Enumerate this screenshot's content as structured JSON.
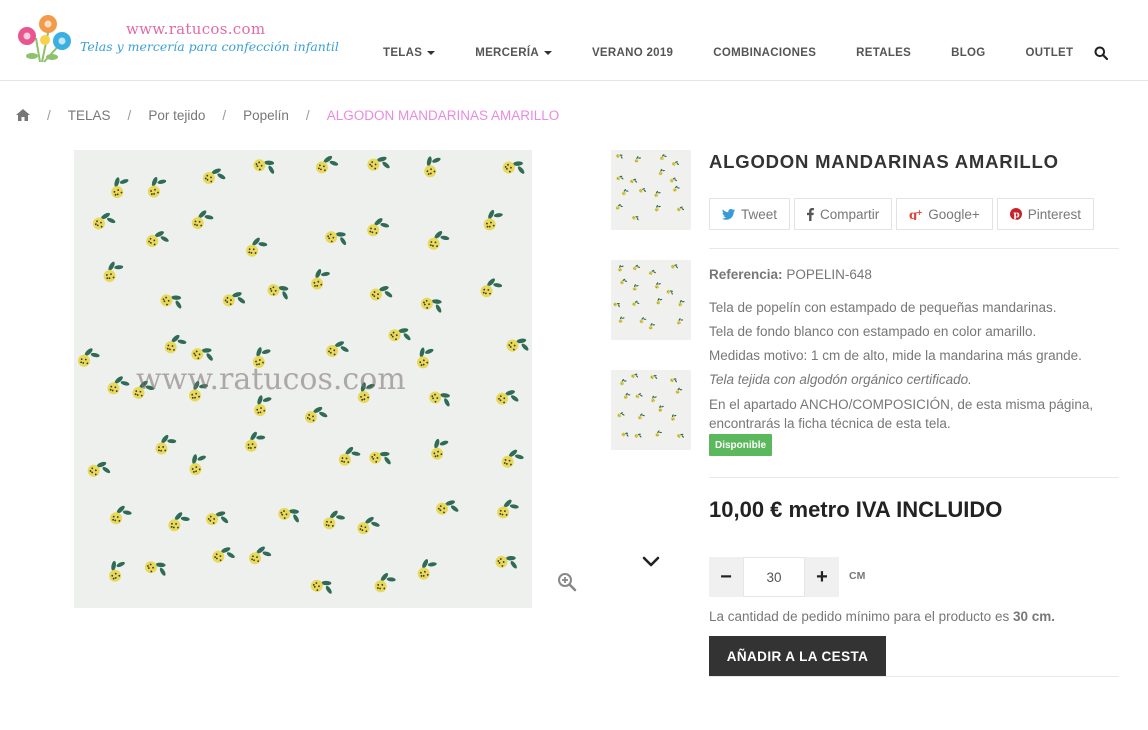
{
  "header": {
    "logo_url": "www.ratucos.com",
    "logo_tagline": "Telas y mercería para confección infantil",
    "nav": [
      {
        "label": "TELAS",
        "dropdown": true
      },
      {
        "label": "MERCERÍA",
        "dropdown": true
      },
      {
        "label": "VERANO 2019",
        "dropdown": false
      },
      {
        "label": "COMBINACIONES",
        "dropdown": false
      },
      {
        "label": "RETALES",
        "dropdown": false
      },
      {
        "label": "BLOG",
        "dropdown": false
      },
      {
        "label": "OUTLET",
        "dropdown": false
      }
    ],
    "search_icon": "search-icon"
  },
  "breadcrumb": {
    "home_icon": "home-icon",
    "separator": "/",
    "items": [
      "TELAS",
      "Por tejido",
      "Popelín"
    ],
    "current": "ALGODON MANDARINAS AMARILLO"
  },
  "gallery": {
    "watermark": "www.ratucos.com",
    "zoom_icon": "zoom-in-icon",
    "next_icon": "chevron-down-icon"
  },
  "product": {
    "title": "ALGODON MANDARINAS AMARILLO",
    "share": [
      {
        "label": "Tweet",
        "icon": "twitter-icon"
      },
      {
        "label": "Compartir",
        "icon": "facebook-icon"
      },
      {
        "label": "Google+",
        "icon": "google-plus-icon"
      },
      {
        "label": "Pinterest",
        "icon": "pinterest-icon"
      }
    ],
    "reference_label": "Referencia:",
    "reference_value": "POPELIN-648",
    "description": [
      "Tela de popelín con estampado de pequeñas mandarinas.",
      "Tela de fondo blanco con estampado en color amarillo.",
      "Medidas motivo: 1 cm de alto, mide la mandarina más grande.",
      "Tela tejida con algodón orgánico certificado.",
      "En el apartado ANCHO/COMPOSICIÓN, de esta misma página, encontrarás la ficha técnica de esta tela."
    ],
    "availability": "Disponible",
    "price": "10,00 € metro IVA INCLUIDO",
    "quantity": {
      "minus": "−",
      "value": "30",
      "plus": "+",
      "unit": "CM"
    },
    "min_order_text": "La cantidad de pedido mínimo para el producto es",
    "min_order_value": "30 cm.",
    "add_to_cart": "AÑADIR A LA CESTA"
  },
  "colors": {
    "accent_pink": "#e98be0",
    "available_green": "#5cb85c",
    "button_dark": "#333333",
    "fruit_yellow": "#e8d95a",
    "leaf_green": "#2f6b55"
  }
}
